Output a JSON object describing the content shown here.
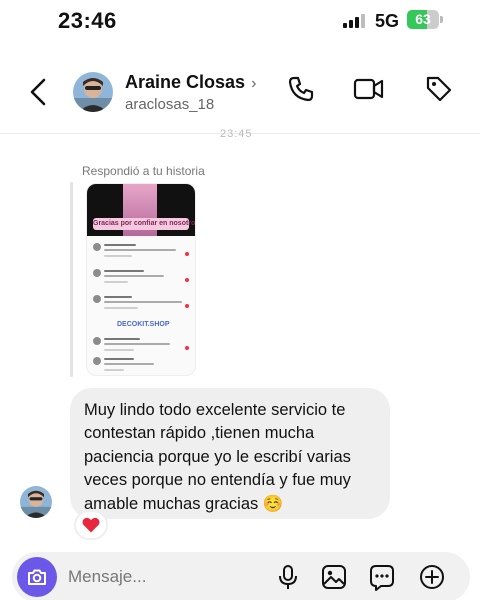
{
  "status_bar": {
    "time": "23:46",
    "network": "5G",
    "battery": "63",
    "battery_fraction": 0.63
  },
  "header": {
    "name": "Araine Closas",
    "username": "araclosas_18",
    "name_chevron": "›",
    "icons": [
      "back-chevron-icon",
      "phone-icon",
      "video-camera-icon",
      "tag-icon"
    ]
  },
  "chat": {
    "partial_timestamp": "23:45",
    "story_reply_label": "Respondió a tu historia",
    "story": {
      "banner_text": "Gracias por confiar en nosotros ❤️",
      "shop_label": "DECOKIT.SHOP"
    },
    "message_text": "Muy lindo todo  excelente servicio te contestan rápido ,tienen mucha paciencia porque yo le escribí varias veces porque no entendía y fue muy amable muchas gracias ☺️",
    "reaction": "❤️"
  },
  "composer": {
    "placeholder": "Mensaje...",
    "icons": [
      "camera-icon",
      "microphone-icon",
      "gallery-icon",
      "sticker-icon",
      "add-icon"
    ]
  },
  "colors": {
    "accent": "#6b57e8",
    "battery": "#34c759",
    "bubble": "#efefef",
    "heart": "#e8273f"
  }
}
